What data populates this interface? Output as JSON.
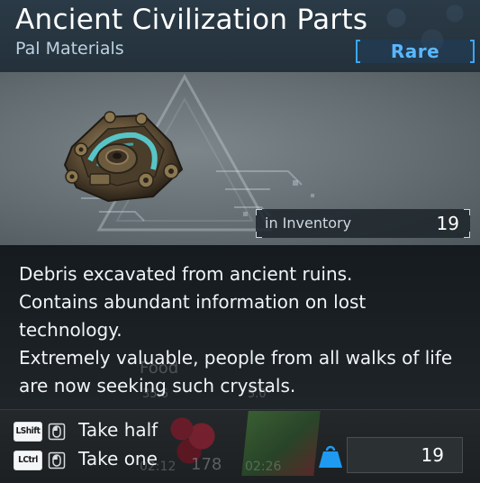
{
  "item": {
    "name": "Ancient Civilization Parts",
    "category": "Pal Materials",
    "rarity": "Rare",
    "inventory_label": "in Inventory",
    "inventory_count": "19",
    "description_lines": [
      "Debris excavated from ancient ruins.",
      "Contains abundant information on lost",
      "technology.",
      "Extremely valuable, people from all walks of life",
      "are now seeking such crystals."
    ]
  },
  "background_ghost": {
    "food_label": "Food",
    "stat_a": "35.6",
    "stat_b": "5.0",
    "count": "178",
    "time_a": "02:12",
    "time_b": "02:26"
  },
  "actions": [
    {
      "key": "LShift",
      "label": "Take half"
    },
    {
      "key": "LCtrl",
      "label": "Take one"
    }
  ],
  "quantity": {
    "value": "19"
  },
  "colors": {
    "rarity": "#3ba7ff",
    "header_bg": "#2a3a46",
    "image_bg": "#6b7479",
    "weight_icon": "#1e9bf0"
  },
  "icons": {
    "item": "ancient-parts-icon",
    "mouse": "mouse-icon",
    "weight": "weight-icon"
  }
}
